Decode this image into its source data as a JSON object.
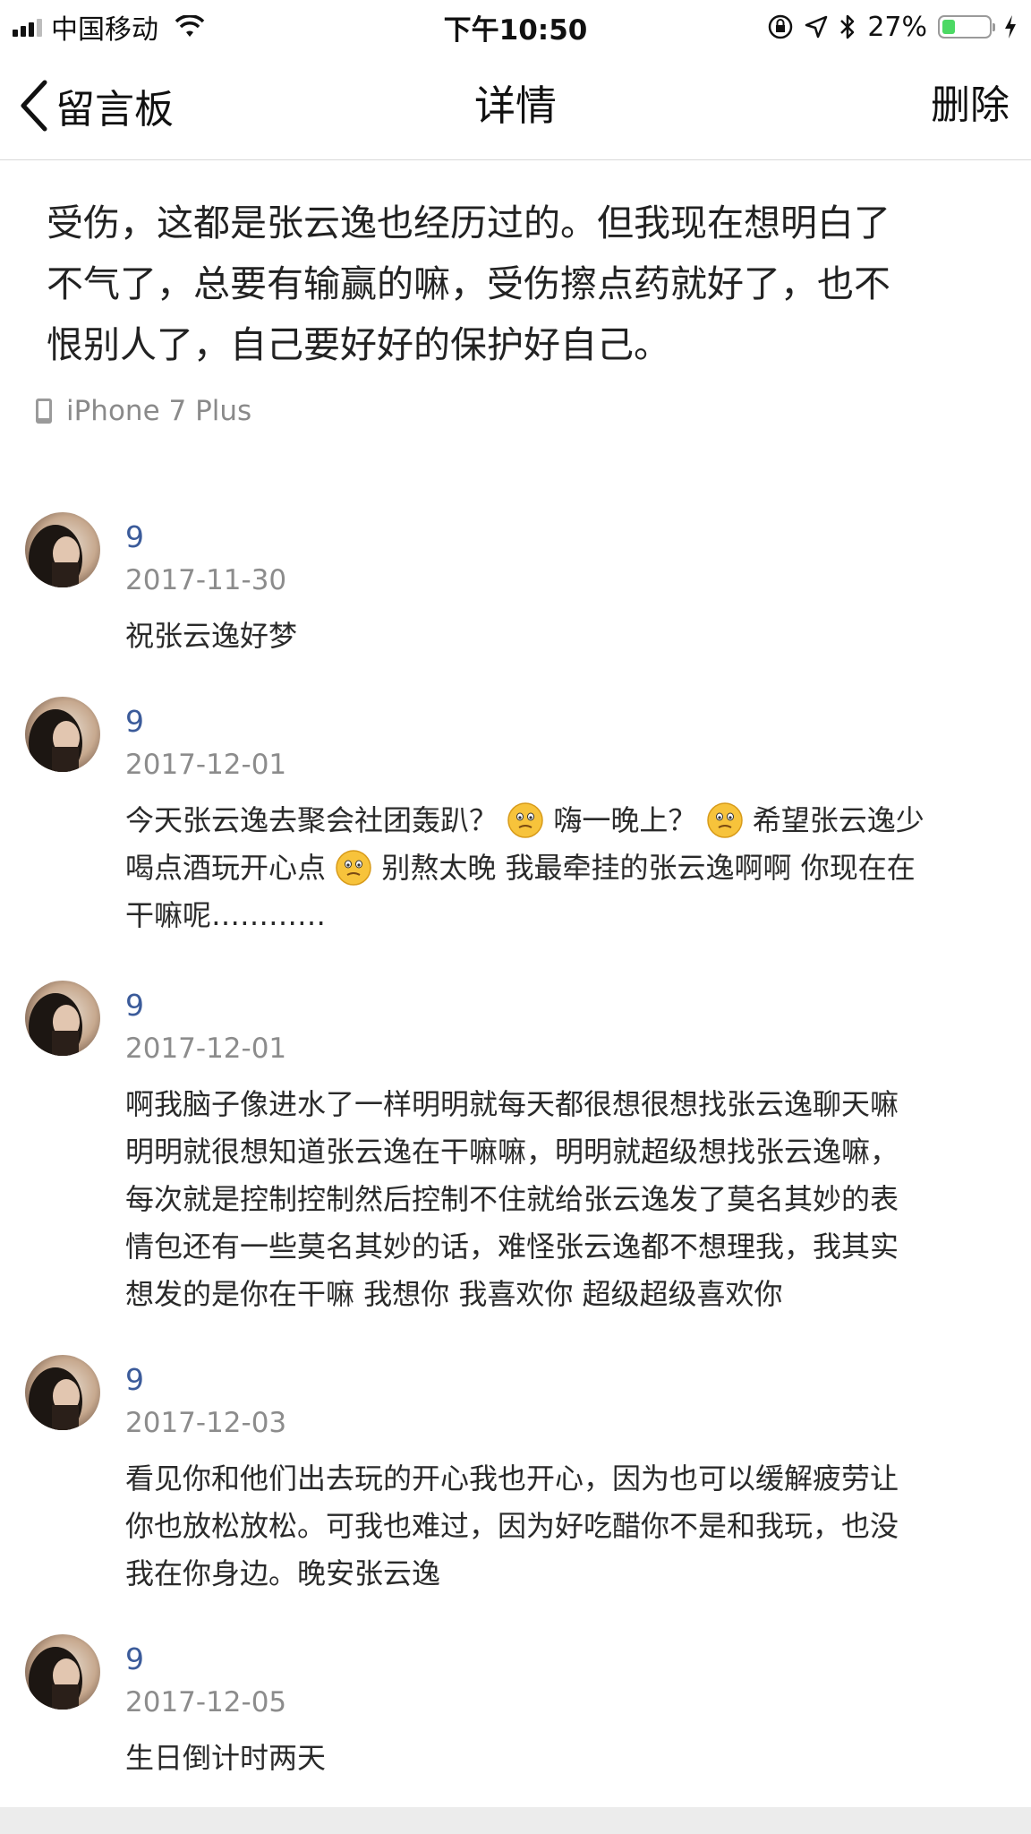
{
  "status_bar": {
    "carrier": "中国移动",
    "time": "下午10:50",
    "battery_percent": "27%",
    "battery_level": 0.27
  },
  "nav": {
    "back_label": "留言板",
    "title": "详情",
    "delete_label": "删除"
  },
  "post": {
    "lines": [
      "受伤，这都是张云逸也经历过的。但我现在想明白了",
      "不气了，总要有输赢的嘛，受伤擦点药就好了，也不",
      "恨别人了，自己要好好的保护好自己。"
    ],
    "device": "iPhone 7 Plus"
  },
  "comments": [
    {
      "name": "9",
      "date": "2017-11-30",
      "text": [
        "祝张云逸好梦"
      ]
    },
    {
      "name": "9",
      "date": "2017-12-01",
      "text": [
        "今天张云逸去聚会社团轰趴？",
        "嗨一晚上？",
        "希望张云逸少",
        "喝点酒玩开心点",
        "别熬太晚 我最牵挂的张云逸啊啊 你现在在",
        "干嘛呢…………"
      ]
    },
    {
      "name": "9",
      "date": "2017-12-01",
      "text": [
        "啊我脑子像进水了一样明明就每天都很想很想找张云逸聊天嘛",
        "明明就很想知道张云逸在干嘛嘛，明明就超级想找张云逸嘛，",
        "每次就是控制控制然后控制不住就给张云逸发了莫名其妙的表",
        "情包还有一些莫名其妙的话，难怪张云逸都不想理我，我其实",
        "想发的是你在干嘛 我想你 我喜欢你 超级超级喜欢你"
      ]
    },
    {
      "name": "9",
      "date": "2017-12-03",
      "text": [
        "看见你和他们出去玩的开心我也开心，因为也可以缓解疲劳让",
        "你也放松放松。可我也难过，因为好吃醋你不是和我玩，也没",
        "我在你身边。晚安张云逸"
      ]
    },
    {
      "name": "9",
      "date": "2017-12-05",
      "text": [
        "生日倒计时两天"
      ]
    }
  ],
  "icons": {
    "back": "chevron-left-icon",
    "device": "phone-icon",
    "emoji": "thinking-face-emoji"
  }
}
